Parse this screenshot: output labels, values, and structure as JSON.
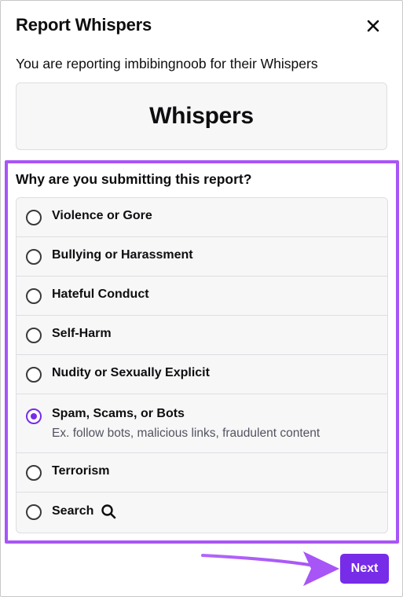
{
  "dialog": {
    "title": "Report Whispers",
    "subtitle": "You are reporting imbibingnoob for their Whispers",
    "content_label": "Whispers"
  },
  "form": {
    "question": "Why are you submitting this report?",
    "options": [
      {
        "label": "Violence or Gore",
        "checked": false
      },
      {
        "label": "Bullying or Harassment",
        "checked": false
      },
      {
        "label": "Hateful Conduct",
        "checked": false
      },
      {
        "label": "Self-Harm",
        "checked": false
      },
      {
        "label": "Nudity or Sexually Explicit",
        "checked": false
      },
      {
        "label": "Spam, Scams, or Bots",
        "description": "Ex. follow bots, malicious links, fraudulent content",
        "checked": true
      },
      {
        "label": "Terrorism",
        "checked": false
      },
      {
        "label": "Search",
        "icon": "search-icon",
        "checked": false
      }
    ]
  },
  "footer": {
    "next_label": "Next"
  },
  "colors": {
    "accent": "#772ce8",
    "highlight": "#a855f7",
    "box_bg": "#f7f7f8"
  }
}
